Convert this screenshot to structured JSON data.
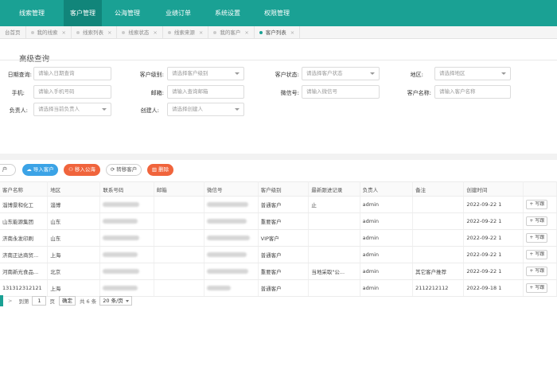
{
  "nav": {
    "items": [
      "线索管理",
      "客户管理",
      "公海管理",
      "业绩订单",
      "系统设置",
      "权限管理"
    ],
    "active_index": 1,
    "accent": "#1aa194"
  },
  "tabs": [
    "台首页",
    "我的线索",
    "线索列表",
    "线索状态",
    "线索来源",
    "我的客户",
    "客户列表"
  ],
  "active_tab": 6,
  "query": {
    "title": "高级查询",
    "fields": [
      {
        "label": "日期查询:",
        "placeholder": "请输入日期查询"
      },
      {
        "label": "客户级别:",
        "placeholder": "请选择客户级别"
      },
      {
        "label": "客户状态:",
        "placeholder": "请选择客户状态"
      },
      {
        "label": "地区:",
        "placeholder": "请选择地区"
      },
      {
        "label": "手机:",
        "placeholder": "请输入手机号码"
      },
      {
        "label": "邮箱:",
        "placeholder": "请输入查询邮箱"
      },
      {
        "label": "微信号:",
        "placeholder": "请输入微信号"
      },
      {
        "label": "客户名称:",
        "placeholder": "请输入客户名称"
      },
      {
        "label": "负责人:",
        "placeholder": "请选择当前负责人"
      },
      {
        "label": "创建人:",
        "placeholder": "请选择创建人"
      }
    ]
  },
  "toolbar": {
    "add": "户",
    "import": "导入客户",
    "move_pool": "移入公海",
    "transfer": "转移客户",
    "delete": "删除"
  },
  "table": {
    "headers": [
      "客户名称",
      "地区",
      "联系号码",
      "邮箱",
      "微信号",
      "客户级别",
      "最新跟进记录",
      "负责人",
      "备注",
      "创建时间",
      ""
    ],
    "rows": [
      {
        "name": "淄博景和化工",
        "region": "淄博",
        "level": "普通客户",
        "followup": "止",
        "owner": "admin",
        "note": "",
        "created": "2022-09-22 1"
      },
      {
        "name": "山东能源集团",
        "region": "山东",
        "level": "重要客户",
        "followup": "",
        "owner": "admin",
        "note": "",
        "created": "2022-09-22 1"
      },
      {
        "name": "济南永发印刷",
        "region": "山东",
        "level": "VIP客户",
        "followup": "",
        "owner": "admin",
        "note": "",
        "created": "2022-09-22 1"
      },
      {
        "name": "济南正达商贸...",
        "region": "上海",
        "level": "普通客户",
        "followup": "",
        "owner": "admin",
        "note": "",
        "created": "2022-09-22 1"
      },
      {
        "name": "河南新光食品...",
        "region": "北京",
        "level": "重要客户",
        "followup": "当地采取\"公...",
        "owner": "admin",
        "note": "其它客户推荐",
        "created": "2022-09-22 1"
      },
      {
        "name": "131312312121",
        "region": "上海",
        "level": "普通客户",
        "followup": "",
        "owner": "admin",
        "note": "2112212112",
        "created": "2022-09-18 1"
      }
    ],
    "action_label": "+ 写跟"
  },
  "pager": {
    "goto": "到第",
    "page": "1",
    "page_unit": "页",
    "confirm": "确定",
    "total": "共 6 条",
    "per_page": "20 条/页"
  }
}
